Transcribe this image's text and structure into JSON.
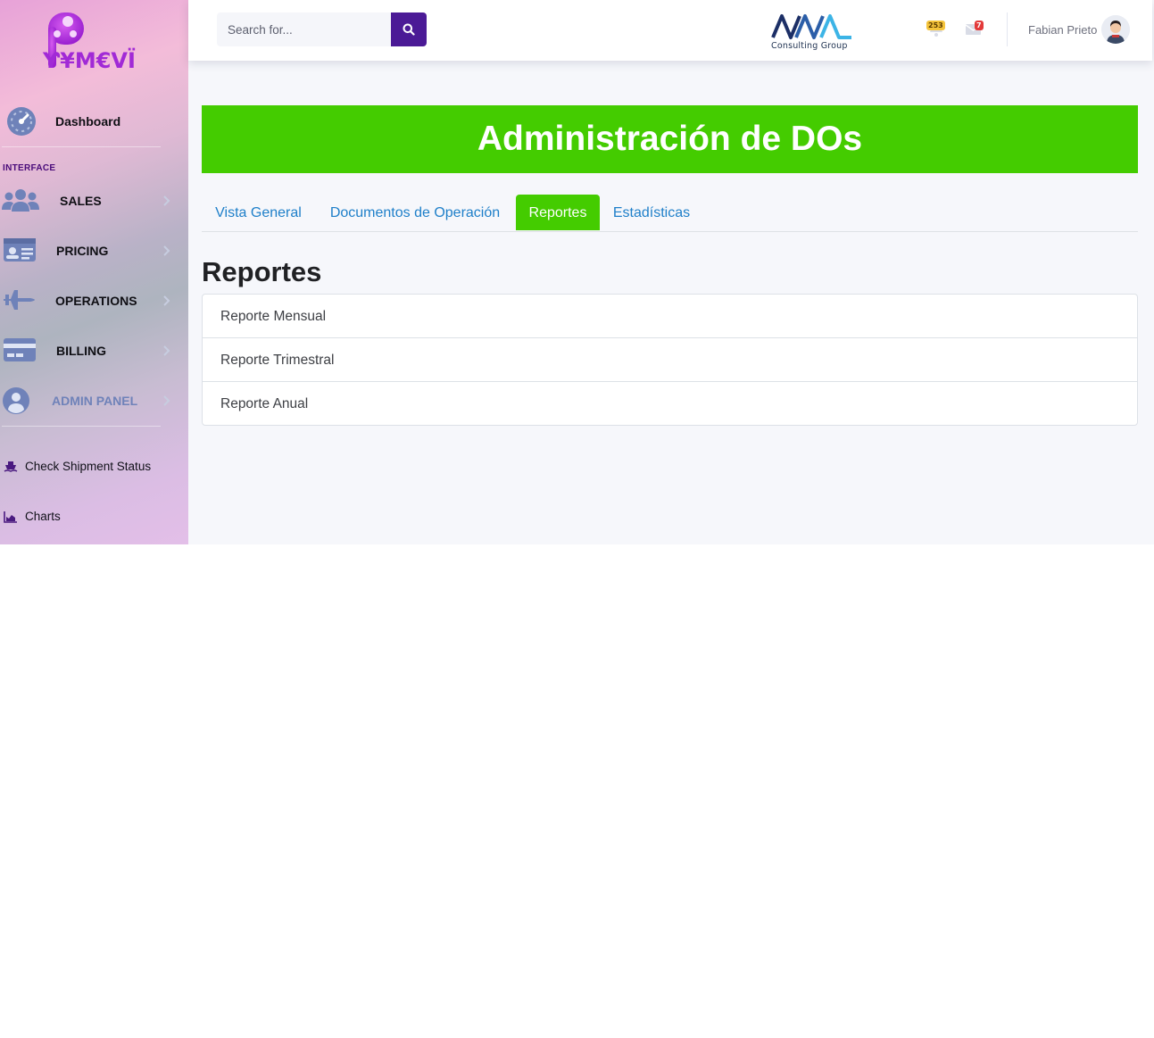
{
  "app": {
    "logo_text": "Ƴ¥M€VÏ"
  },
  "sidebar": {
    "dashboard_label": "Dashboard",
    "section_heading": "INTERFACE",
    "items": [
      {
        "label": "SALES",
        "icon": "users-icon"
      },
      {
        "label": "PRICING",
        "icon": "id-card-icon"
      },
      {
        "label": "OPERATIONS",
        "icon": "fighter-jet-icon"
      },
      {
        "label": "BILLING",
        "icon": "credit-card-icon"
      },
      {
        "label": "ADMIN PANEL",
        "icon": "user-circle-icon"
      }
    ],
    "links": [
      {
        "label": "Check Shipment Status",
        "icon": "ship-icon"
      },
      {
        "label": "Charts",
        "icon": "area-chart-icon"
      }
    ]
  },
  "topbar": {
    "search": {
      "placeholder": "Search for..."
    },
    "brand_subtitle": "Consulting Group",
    "alerts_count": "253",
    "messages_count": "7",
    "user_name": "Fabian Prieto"
  },
  "main": {
    "banner_title": "Administración de DOs",
    "tabs": [
      {
        "label": "Vista General",
        "active": false
      },
      {
        "label": "Documentos de Operación",
        "active": false
      },
      {
        "label": "Reportes",
        "active": true
      },
      {
        "label": "Estadísticas",
        "active": false
      }
    ],
    "section_title": "Reportes",
    "reports": [
      "Reporte Mensual",
      "Reporte Trimestral",
      "Reporte Anual"
    ]
  },
  "colors": {
    "accent_green": "#44cc00",
    "search_button": "#4b1a96",
    "tab_link": "#1e7fc9",
    "sidebar_icon": "#6f82b9"
  }
}
